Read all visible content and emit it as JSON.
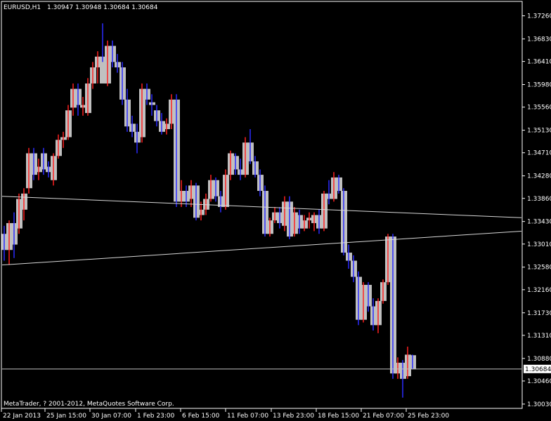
{
  "header": {
    "symbol": "EURUSD,H1",
    "ohlc": "1.30947 1.30948 1.30684 1.30684"
  },
  "footer": {
    "copyright": "MetaTrader, ? 2001-2012, MetaQuotes Software Corp."
  },
  "colors": {
    "background": "#000000",
    "frame": "#ffffff",
    "bull_wick": "#ff2020",
    "bear_wick": "#2a2aff",
    "body_fill": "#c0c0c0",
    "trendline": "#d8d8d8",
    "price_line": "#c0c0c0",
    "price_box_fill": "#ffffff",
    "price_box_text": "#000000"
  },
  "chart_data": {
    "type": "candlestick",
    "title": "EURUSD,H1",
    "ylim": [
      1.2995,
      1.3745
    ],
    "y_ticks": [
      "1.37260",
      "1.36830",
      "1.36410",
      "1.35980",
      "1.35560",
      "1.35130",
      "1.34710",
      "1.34280",
      "1.33860",
      "1.33430",
      "1.33010",
      "1.32580",
      "1.32160",
      "1.31730",
      "1.31310",
      "1.30880",
      "1.30460",
      "1.30030"
    ],
    "x_ticks": [
      "22 Jan 2013",
      "25 Jan 15:00",
      "30 Jan 07:00",
      "1 Feb 23:00",
      "6 Feb 15:00",
      "11 Feb 07:00",
      "13 Feb 23:00",
      "18 Feb 15:00",
      "21 Feb 07:00",
      "25 Feb 23:00"
    ],
    "current_price": "1.30684",
    "trendlines": [
      {
        "name": "upper",
        "start": {
          "x": "22 Jan 2013",
          "y": 1.339
        },
        "end": {
          "x": "25 Feb 23:00",
          "y": 1.335
        }
      },
      {
        "name": "lower",
        "start": {
          "x": "22 Jan 2013",
          "y": 1.3262
        },
        "end": {
          "x": "25 Feb 23:00",
          "y": 1.3325
        }
      }
    ],
    "bars": [
      {
        "o": 1.332,
        "h": 1.3335,
        "l": 1.327,
        "c": 1.329
      },
      {
        "o": 1.329,
        "h": 1.3345,
        "l": 1.3262,
        "c": 1.334
      },
      {
        "o": 1.334,
        "h": 1.336,
        "l": 1.3275,
        "c": 1.33
      },
      {
        "o": 1.333,
        "h": 1.3395,
        "l": 1.332,
        "c": 1.3385
      },
      {
        "o": 1.3365,
        "h": 1.3405,
        "l": 1.3345,
        "c": 1.3395
      },
      {
        "o": 1.3405,
        "h": 1.348,
        "l": 1.3395,
        "c": 1.347
      },
      {
        "o": 1.347,
        "h": 1.348,
        "l": 1.342,
        "c": 1.343
      },
      {
        "o": 1.3435,
        "h": 1.346,
        "l": 1.342,
        "c": 1.3445
      },
      {
        "o": 1.347,
        "h": 1.348,
        "l": 1.343,
        "c": 1.344
      },
      {
        "o": 1.3445,
        "h": 1.3455,
        "l": 1.3425,
        "c": 1.3435
      },
      {
        "o": 1.342,
        "h": 1.347,
        "l": 1.341,
        "c": 1.3465
      },
      {
        "o": 1.3465,
        "h": 1.3505,
        "l": 1.346,
        "c": 1.3495
      },
      {
        "o": 1.3495,
        "h": 1.351,
        "l": 1.348,
        "c": 1.35
      },
      {
        "o": 1.35,
        "h": 1.356,
        "l": 1.3495,
        "c": 1.355
      },
      {
        "o": 1.3555,
        "h": 1.36,
        "l": 1.354,
        "c": 1.359
      },
      {
        "o": 1.359,
        "h": 1.36,
        "l": 1.354,
        "c": 1.356
      },
      {
        "o": 1.3555,
        "h": 1.3575,
        "l": 1.354,
        "c": 1.356
      },
      {
        "o": 1.3545,
        "h": 1.361,
        "l": 1.354,
        "c": 1.36
      },
      {
        "o": 1.36,
        "h": 1.364,
        "l": 1.359,
        "c": 1.363
      },
      {
        "o": 1.363,
        "h": 1.366,
        "l": 1.36,
        "c": 1.365
      },
      {
        "o": 1.365,
        "h": 1.3712,
        "l": 1.364,
        "c": 1.36
      },
      {
        "o": 1.36,
        "h": 1.368,
        "l": 1.3595,
        "c": 1.367
      },
      {
        "o": 1.367,
        "h": 1.368,
        "l": 1.363,
        "c": 1.364
      },
      {
        "o": 1.364,
        "h": 1.3655,
        "l": 1.362,
        "c": 1.363
      },
      {
        "o": 1.363,
        "h": 1.364,
        "l": 1.356,
        "c": 1.357
      },
      {
        "o": 1.357,
        "h": 1.359,
        "l": 1.351,
        "c": 1.352
      },
      {
        "o": 1.3525,
        "h": 1.354,
        "l": 1.35,
        "c": 1.351
      },
      {
        "o": 1.351,
        "h": 1.3525,
        "l": 1.347,
        "c": 1.349
      },
      {
        "o": 1.35,
        "h": 1.36,
        "l": 1.349,
        "c": 1.359
      },
      {
        "o": 1.359,
        "h": 1.36,
        "l": 1.356,
        "c": 1.357
      },
      {
        "o": 1.3565,
        "h": 1.358,
        "l": 1.354,
        "c": 1.356
      },
      {
        "o": 1.355,
        "h": 1.356,
        "l": 1.352,
        "c": 1.353
      },
      {
        "o": 1.353,
        "h": 1.3545,
        "l": 1.3505,
        "c": 1.351
      },
      {
        "o": 1.3515,
        "h": 1.3535,
        "l": 1.3505,
        "c": 1.3525
      },
      {
        "o": 1.3525,
        "h": 1.358,
        "l": 1.3515,
        "c": 1.357
      },
      {
        "o": 1.357,
        "h": 1.358,
        "l": 1.337,
        "c": 1.338
      },
      {
        "o": 1.338,
        "h": 1.342,
        "l": 1.337,
        "c": 1.34
      },
      {
        "o": 1.34,
        "h": 1.341,
        "l": 1.337,
        "c": 1.338
      },
      {
        "o": 1.3385,
        "h": 1.342,
        "l": 1.337,
        "c": 1.341
      },
      {
        "o": 1.341,
        "h": 1.3415,
        "l": 1.3345,
        "c": 1.335
      },
      {
        "o": 1.3355,
        "h": 1.338,
        "l": 1.3345,
        "c": 1.3365
      },
      {
        "o": 1.3365,
        "h": 1.3395,
        "l": 1.3355,
        "c": 1.3385
      },
      {
        "o": 1.3385,
        "h": 1.343,
        "l": 1.338,
        "c": 1.342
      },
      {
        "o": 1.342,
        "h": 1.3425,
        "l": 1.338,
        "c": 1.339
      },
      {
        "o": 1.339,
        "h": 1.34,
        "l": 1.336,
        "c": 1.337
      },
      {
        "o": 1.337,
        "h": 1.344,
        "l": 1.3365,
        "c": 1.343
      },
      {
        "o": 1.343,
        "h": 1.3475,
        "l": 1.342,
        "c": 1.347
      },
      {
        "o": 1.3465,
        "h": 1.347,
        "l": 1.343,
        "c": 1.344
      },
      {
        "o": 1.344,
        "h": 1.346,
        "l": 1.342,
        "c": 1.343
      },
      {
        "o": 1.343,
        "h": 1.35,
        "l": 1.3425,
        "c": 1.349
      },
      {
        "o": 1.349,
        "h": 1.3515,
        "l": 1.345,
        "c": 1.3455
      },
      {
        "o": 1.3455,
        "h": 1.3465,
        "l": 1.3425,
        "c": 1.343
      },
      {
        "o": 1.343,
        "h": 1.344,
        "l": 1.339,
        "c": 1.34
      },
      {
        "o": 1.34,
        "h": 1.341,
        "l": 1.3315,
        "c": 1.332
      },
      {
        "o": 1.332,
        "h": 1.335,
        "l": 1.3315,
        "c": 1.3345
      },
      {
        "o": 1.3345,
        "h": 1.337,
        "l": 1.334,
        "c": 1.336
      },
      {
        "o": 1.336,
        "h": 1.337,
        "l": 1.333,
        "c": 1.334
      },
      {
        "o": 1.3335,
        "h": 1.339,
        "l": 1.3325,
        "c": 1.338
      },
      {
        "o": 1.338,
        "h": 1.339,
        "l": 1.331,
        "c": 1.3315
      },
      {
        "o": 1.332,
        "h": 1.337,
        "l": 1.3315,
        "c": 1.336
      },
      {
        "o": 1.3355,
        "h": 1.3365,
        "l": 1.332,
        "c": 1.333
      },
      {
        "o": 1.333,
        "h": 1.3355,
        "l": 1.3325,
        "c": 1.3345
      },
      {
        "o": 1.3345,
        "h": 1.336,
        "l": 1.333,
        "c": 1.335
      },
      {
        "o": 1.334,
        "h": 1.336,
        "l": 1.3325,
        "c": 1.3355
      },
      {
        "o": 1.3355,
        "h": 1.3365,
        "l": 1.332,
        "c": 1.333
      },
      {
        "o": 1.333,
        "h": 1.34,
        "l": 1.3325,
        "c": 1.3395
      },
      {
        "o": 1.3395,
        "h": 1.342,
        "l": 1.3375,
        "c": 1.3385
      },
      {
        "o": 1.3385,
        "h": 1.3435,
        "l": 1.338,
        "c": 1.3425
      },
      {
        "o": 1.3425,
        "h": 1.343,
        "l": 1.3395,
        "c": 1.34
      },
      {
        "o": 1.34,
        "h": 1.3405,
        "l": 1.328,
        "c": 1.3285
      },
      {
        "o": 1.3285,
        "h": 1.33,
        "l": 1.3255,
        "c": 1.327
      },
      {
        "o": 1.327,
        "h": 1.328,
        "l": 1.323,
        "c": 1.324
      },
      {
        "o": 1.324,
        "h": 1.325,
        "l": 1.315,
        "c": 1.316
      },
      {
        "o": 1.316,
        "h": 1.323,
        "l": 1.3155,
        "c": 1.3225
      },
      {
        "o": 1.3225,
        "h": 1.323,
        "l": 1.3175,
        "c": 1.3185
      },
      {
        "o": 1.3185,
        "h": 1.32,
        "l": 1.314,
        "c": 1.315
      },
      {
        "o": 1.315,
        "h": 1.32,
        "l": 1.3135,
        "c": 1.3195
      },
      {
        "o": 1.3195,
        "h": 1.3235,
        "l": 1.319,
        "c": 1.323
      },
      {
        "o": 1.323,
        "h": 1.332,
        "l": 1.3225,
        "c": 1.3315
      },
      {
        "o": 1.3315,
        "h": 1.332,
        "l": 1.305,
        "c": 1.306
      },
      {
        "o": 1.306,
        "h": 1.309,
        "l": 1.305,
        "c": 1.308
      },
      {
        "o": 1.308,
        "h": 1.3085,
        "l": 1.3015,
        "c": 1.305
      },
      {
        "o": 1.3055,
        "h": 1.311,
        "l": 1.305,
        "c": 1.3095
      },
      {
        "o": 1.3094,
        "h": 1.3095,
        "l": 1.3068,
        "c": 1.3068
      }
    ]
  }
}
